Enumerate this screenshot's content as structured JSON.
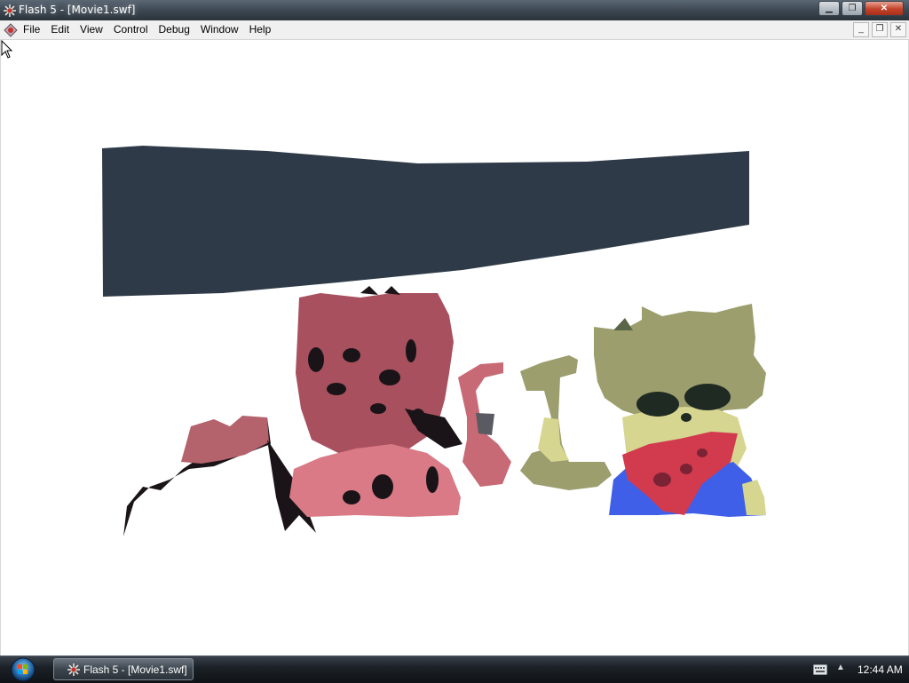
{
  "window": {
    "title": "Flash 5 - [Movie1.swf]",
    "icon": "flash-player-icon",
    "controls": {
      "minimize": "minimize-icon",
      "maximize": "restore-icon",
      "close": "close-icon"
    }
  },
  "menubar": {
    "items": [
      "File",
      "Edit",
      "View",
      "Control",
      "Debug",
      "Window",
      "Help"
    ]
  },
  "mdi_controls": [
    "minimize-icon",
    "restore-icon",
    "close-icon"
  ],
  "stage": {
    "background": "#ffffff",
    "colors": {
      "banner": "#2e3a47",
      "char_left": "#b4626b",
      "char_left_light": "#d97a86",
      "outline": "#1a1418",
      "char_right": "#9c9e6e",
      "char_right_light": "#d6d690",
      "red": "#d23a4e",
      "blue": "#3f5fe8"
    }
  },
  "taskbar": {
    "task_button_label": "Flash 5 - [Movie1.swf]",
    "clock": "12:44 AM"
  }
}
